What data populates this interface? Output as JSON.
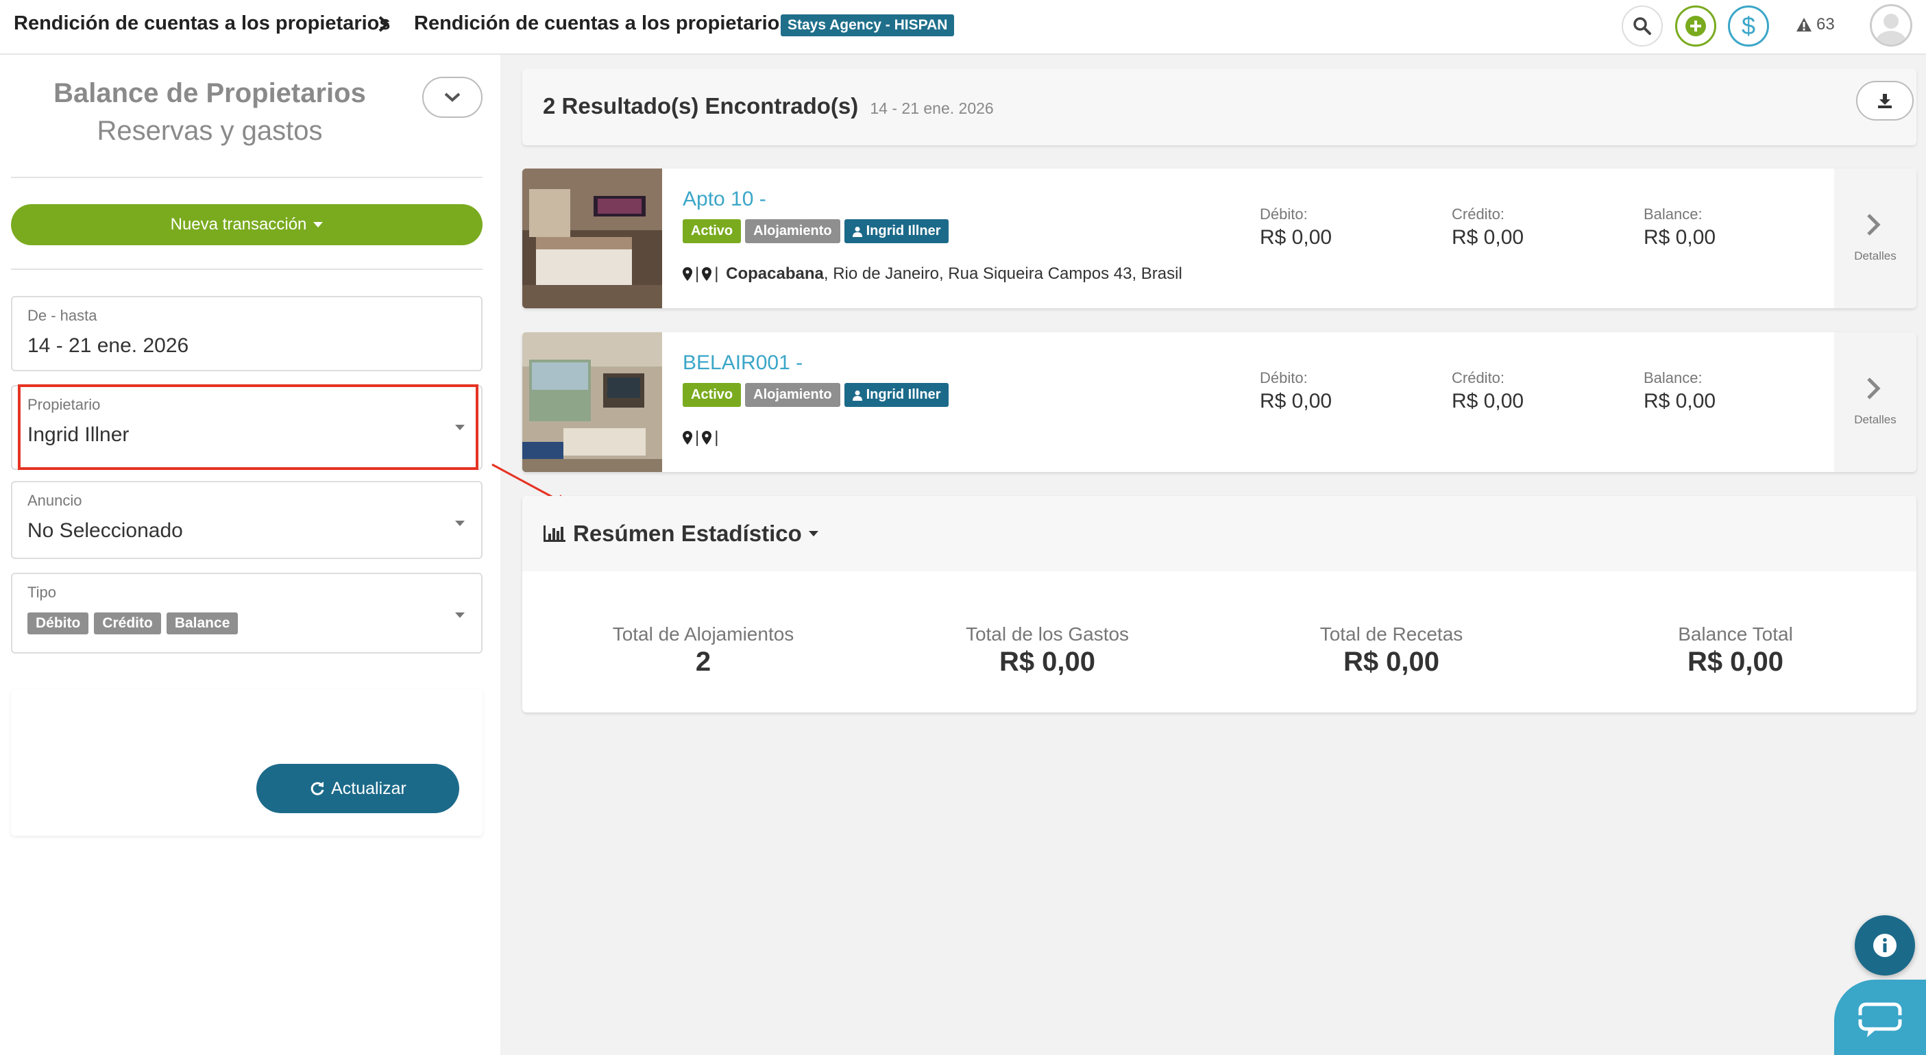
{
  "breadcrumb": {
    "first": "Rendición de cuentas a los propietarios",
    "second": "Rendición de cuentas a los propietarios",
    "agency_badge": "Stays Agency - HISPAN"
  },
  "topbar": {
    "alerts_count": "63"
  },
  "sidebar": {
    "title": "Balance de Propietarios",
    "subtitle": "Reservas y gastos",
    "new_transaction": "Nueva transacción",
    "date_range": {
      "label": "De - hasta",
      "value": "14 - 21 ene. 2026"
    },
    "owner": {
      "label": "Propietario",
      "value": "Ingrid Illner"
    },
    "listing": {
      "label": "Anuncio",
      "value": "No Seleccionado"
    },
    "type": {
      "label": "Tipo",
      "tags": [
        "Débito",
        "Crédito",
        "Balance"
      ]
    },
    "update_button": "Actualizar"
  },
  "results": {
    "title": "2 Resultado(s) Encontrado(s)",
    "range": "14 - 21 ene. 2026"
  },
  "properties": [
    {
      "name": "Apto 10 -",
      "status": "Activo",
      "category": "Alojamiento",
      "owner": "Ingrid Illner",
      "address_prefix": "| ",
      "neighborhood": "Copacabana",
      "address_rest": ", Rio de Janeiro, Rua Siqueira Campos 43, Brasil",
      "debit_label": "Débito:",
      "debit": "R$ 0,00",
      "credit_label": "Crédito:",
      "credit": "R$ 0,00",
      "balance_label": "Balance:",
      "balance": "R$ 0,00",
      "details": "Detalles"
    },
    {
      "name": "BELAIR001 -",
      "status": "Activo",
      "category": "Alojamiento",
      "owner": "Ingrid Illner",
      "address_prefix": "|",
      "neighborhood": "",
      "address_rest": "",
      "debit_label": "Débito:",
      "debit": "R$ 0,00",
      "credit_label": "Crédito:",
      "credit": "R$ 0,00",
      "balance_label": "Balance:",
      "balance": "R$ 0,00",
      "details": "Detalles"
    }
  ],
  "stats": {
    "title": "Resúmen Estadístico",
    "items": [
      {
        "label": "Total de Alojamientos",
        "value": "2"
      },
      {
        "label": "Total de los Gastos",
        "value": "R$ 0,00"
      },
      {
        "label": "Total de Recetas",
        "value": "R$ 0,00"
      },
      {
        "label": "Balance Total",
        "value": "R$ 0,00"
      }
    ]
  },
  "colors": {
    "brand_blue": "#1c6a8a",
    "accent_green": "#7aab1f",
    "link_blue": "#3aa6c8",
    "highlight_red": "#e53323"
  },
  "icons": [
    "search-icon",
    "plus-icon",
    "dollar-icon",
    "warning-icon",
    "avatar-icon",
    "chevron-down-icon",
    "download-icon",
    "map-pin-icon",
    "user-icon",
    "chevron-right-icon",
    "bar-chart-icon",
    "refresh-icon",
    "info-icon",
    "chat-icon"
  ]
}
